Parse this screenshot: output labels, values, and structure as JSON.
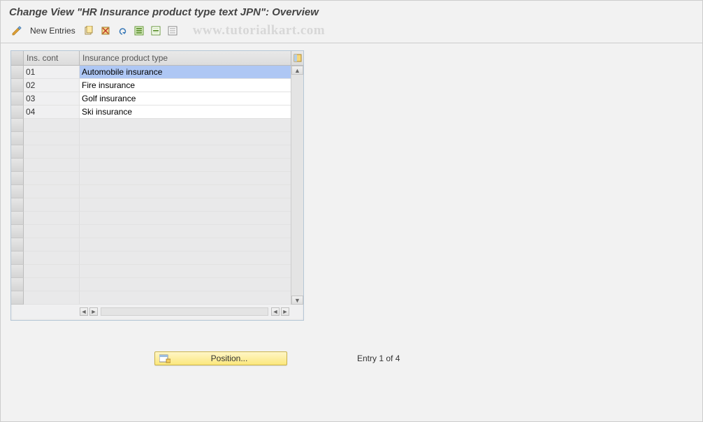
{
  "title": "Change View \"HR Insurance product type text JPN\": Overview",
  "toolbar": {
    "new_entries": "New Entries"
  },
  "watermark": "www.tutorialkart.com",
  "table": {
    "col_ins": "Ins. cont",
    "col_type": "Insurance product type",
    "rows": [
      {
        "ins": "01",
        "type": "Automobile insurance"
      },
      {
        "ins": "02",
        "type": "Fire insurance"
      },
      {
        "ins": "03",
        "type": "Golf insurance"
      },
      {
        "ins": "04",
        "type": "Ski insurance"
      }
    ]
  },
  "footer": {
    "position": "Position...",
    "entry": "Entry 1 of 4"
  }
}
